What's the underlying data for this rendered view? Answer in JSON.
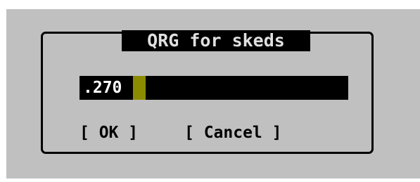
{
  "dialog": {
    "title": " QRG for skeds ",
    "input": {
      "value": ".270"
    },
    "buttons": {
      "ok_label": "[ OK ]",
      "cancel_label": "[ Cancel ]"
    }
  },
  "colors": {
    "screen_background": "#c0c0c0",
    "frame": "#000000",
    "title_background": "#000000",
    "title_text": "#e0e0e0",
    "field_background": "#000000",
    "field_text": "#ffffff",
    "cursor": "#8c8b00",
    "button_text": "#000000"
  }
}
